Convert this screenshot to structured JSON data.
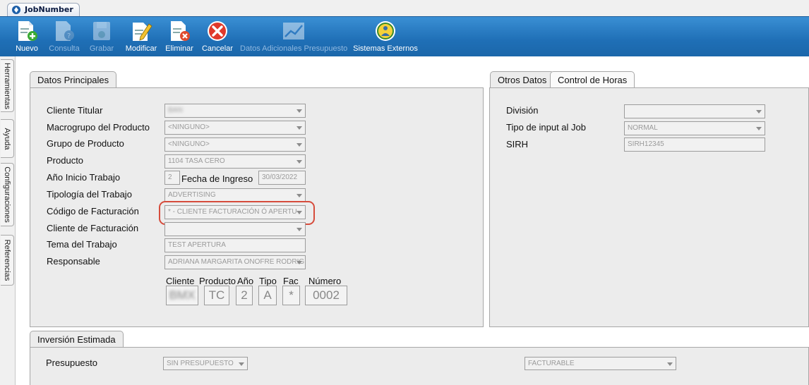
{
  "window": {
    "tab_title": "JobNumber"
  },
  "toolbar": {
    "nuevo": "Nuevo",
    "consulta": "Consulta",
    "grabar": "Grabar",
    "modificar": "Modificar",
    "eliminar": "Eliminar",
    "cancelar": "Cancelar",
    "datos_adicionales": "Datos Adicionales Presupuesto",
    "sistemas_externos": "Sistemas Externos"
  },
  "side_tabs": [
    "Herramientas",
    "Ayuda",
    "Configuraciones",
    "Referencias"
  ],
  "principal": {
    "tab_label": "Datos Principales",
    "cliente_titular": {
      "label": "Cliente Titular",
      "value": "BAN"
    },
    "macrogrupo": {
      "label": "Macrogrupo del Producto",
      "value": "<NINGUNO>"
    },
    "grupo": {
      "label": "Grupo de Producto",
      "value": "<NINGUNO>"
    },
    "producto": {
      "label": "Producto",
      "value": "1104 TASA CERO"
    },
    "anio_inicio": {
      "label": "Año Inicio Trabajo",
      "value": "2"
    },
    "fecha_ingreso": {
      "label": "Fecha de Ingreso",
      "value": "30/03/2022"
    },
    "tipologia": {
      "label": "Tipología del Trabajo",
      "value": "ADVERTISING"
    },
    "codigo_facturacion": {
      "label": "Código de Facturación",
      "value": "* - CLIENTE FACTURACIÓN Ó APERTU"
    },
    "cliente_facturacion": {
      "label": "Cliente de Facturación",
      "value": ""
    },
    "tema": {
      "label": "Tema del Trabajo",
      "value": "TEST APERTURA"
    },
    "responsable": {
      "label": "Responsable",
      "value": "ADRIANA MARGARITA ONOFRE RODRIG"
    },
    "code": {
      "headers": {
        "cliente": "Cliente",
        "producto": "Producto",
        "anio": "Año",
        "tipo": "Tipo",
        "fac": "Fac",
        "numero": "Número"
      },
      "values": {
        "cliente": "BMX",
        "producto": "TC",
        "anio": "2",
        "tipo": "A",
        "fac": "*",
        "numero": "0002"
      }
    }
  },
  "otros": {
    "tab_otros": "Otros Datos",
    "tab_horas": "Control de Horas",
    "division": {
      "label": "División",
      "value": ""
    },
    "tipo_input": {
      "label": "Tipo de input al Job",
      "value": "NORMAL"
    },
    "sirh": {
      "label": "SIRH",
      "value": "SIRH12345"
    }
  },
  "inversion": {
    "tab_label": "Inversión Estimada",
    "presupuesto": {
      "label": "Presupuesto",
      "value": "SIN PRESUPUESTO"
    },
    "facturable": {
      "value": "FACTURABLE"
    }
  }
}
